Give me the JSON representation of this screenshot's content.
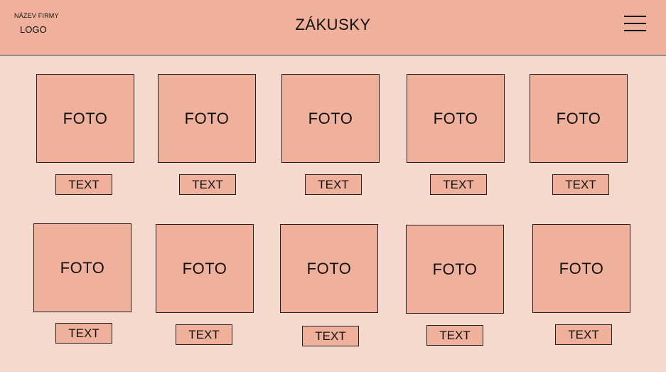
{
  "header": {
    "company_name": "NÁZEV FIRMY",
    "logo": "LOGO",
    "title": "ZÁKUSKY",
    "menu_icon": "hamburger-menu-icon"
  },
  "products": [
    {
      "photo": "FOTO",
      "text": "TEXT"
    },
    {
      "photo": "FOTO",
      "text": "TEXT"
    },
    {
      "photo": "FOTO",
      "text": "TEXT"
    },
    {
      "photo": "FOTO",
      "text": "TEXT"
    },
    {
      "photo": "FOTO",
      "text": "TEXT"
    },
    {
      "photo": "FOTO",
      "text": "TEXT"
    },
    {
      "photo": "FOTO",
      "text": "TEXT"
    },
    {
      "photo": "FOTO",
      "text": "TEXT"
    },
    {
      "photo": "FOTO",
      "text": "TEXT"
    },
    {
      "photo": "FOTO",
      "text": "TEXT"
    }
  ],
  "colors": {
    "header_background": "#efb19b",
    "page_background": "#f6d9cd",
    "tile_background": "#efb19b"
  }
}
